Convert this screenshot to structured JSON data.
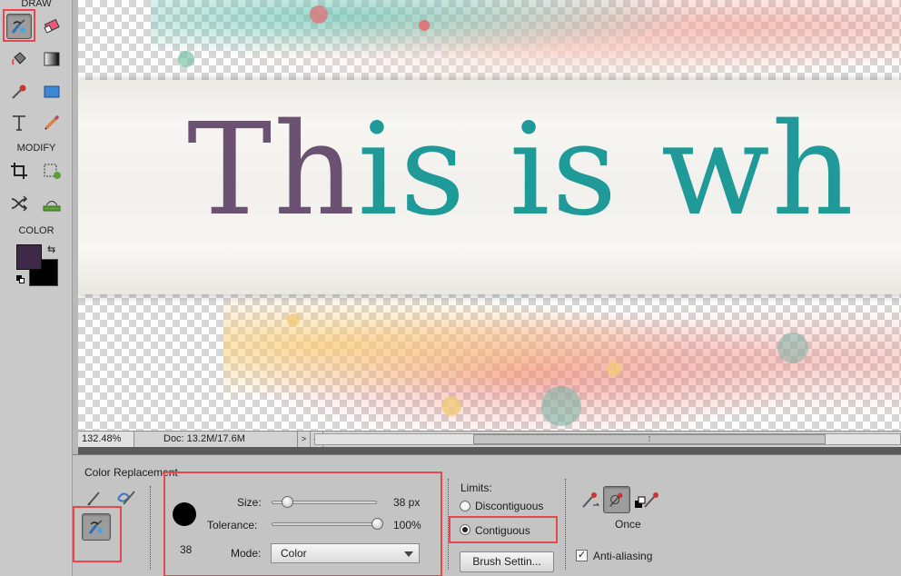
{
  "toolbar": {
    "sections": {
      "draw": "DRAW",
      "modify": "MODIFY",
      "color": "COLOR"
    },
    "colors": {
      "foreground": "#3f2a49",
      "background": "#000000"
    }
  },
  "canvas": {
    "headline_part1": "Th",
    "headline_part2": "is is wh"
  },
  "status": {
    "zoom": "132.48%",
    "doc": "Doc: 13.2M/17.6M",
    "arrow": ">"
  },
  "options": {
    "title": "Color Replacement",
    "brush_preview_size": "38",
    "size_label": "Size:",
    "size_value": "38 px",
    "size_level": 0.15,
    "tolerance_label": "Tolerance:",
    "tolerance_value": "100%",
    "tolerance_level": 1.0,
    "mode_label": "Mode:",
    "mode_value": "Color",
    "limits_label": "Limits:",
    "limit_discontiguous": "Discontiguous",
    "limit_contiguous": "Contiguous",
    "limit_selected": "Contiguous",
    "brush_settings": "Brush Settin...",
    "sampling_label": "Once",
    "anti_aliasing": "Anti-aliasing",
    "anti_aliasing_checked": true
  },
  "highlight_color": "#e8474c"
}
